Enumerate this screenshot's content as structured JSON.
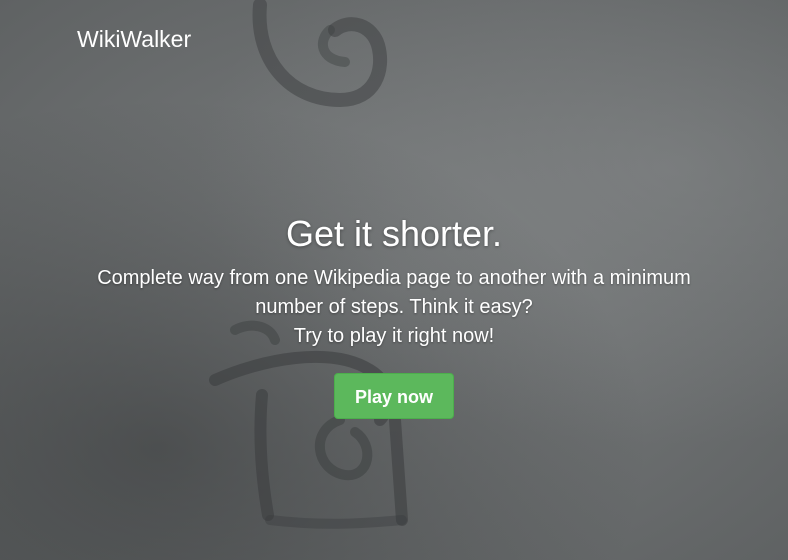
{
  "navbar": {
    "brand": "WikiWalker"
  },
  "hero": {
    "title": "Get it shorter.",
    "lead_line1": "Complete way from one Wikipedia page to another with a minimum",
    "lead_line2": "number of steps. Think it easy?",
    "lead_line3": "Try to play it right now!",
    "cta_label": "Play now"
  },
  "colors": {
    "cta_background": "#5cb85c",
    "text": "#ffffff",
    "background": "#6b6e6f"
  }
}
